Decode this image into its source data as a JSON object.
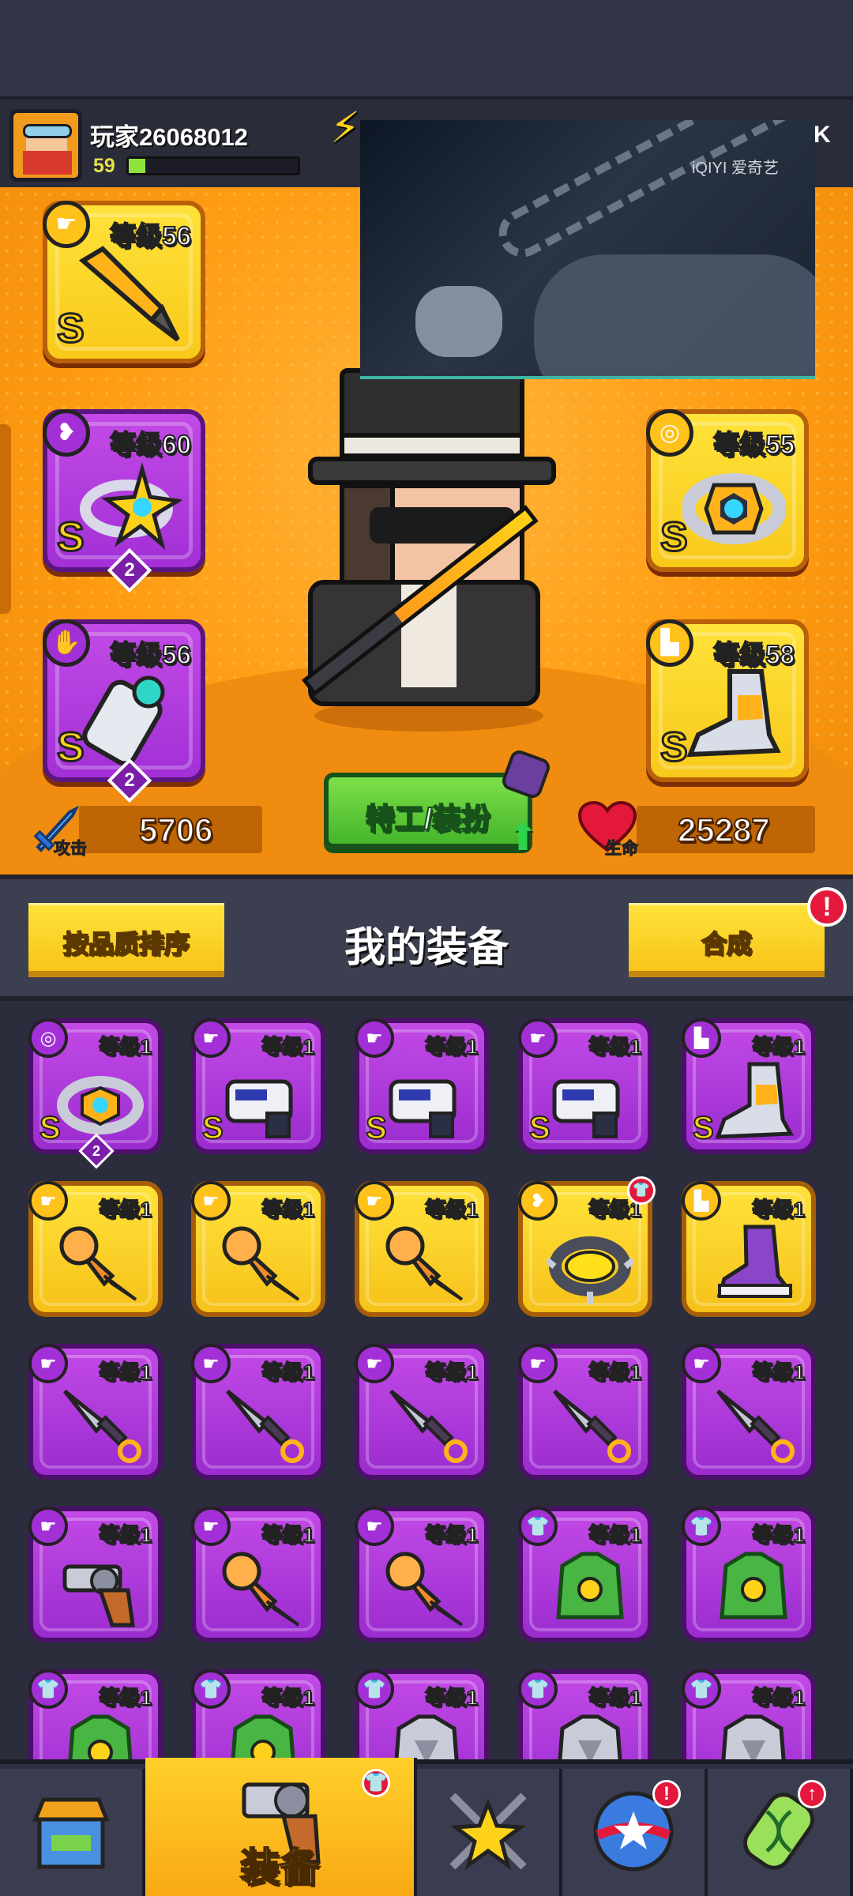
{
  "player": {
    "name": "玩家26068012",
    "level": "59",
    "xp_fraction": 0.1
  },
  "hud": {
    "k_label": "K"
  },
  "video": {
    "watermark": "iQIYI 爱奇艺"
  },
  "equipped": [
    {
      "level": "等级56",
      "grade": "S",
      "slot_icon": "pistol-icon",
      "item": "flame-sword",
      "rarity": "gold"
    },
    {
      "level": "等级60",
      "grade": "S",
      "slot_icon": "necklace-icon",
      "item": "star-ring",
      "rarity": "purple",
      "stars": "2"
    },
    {
      "level": "等级56",
      "grade": "S",
      "slot_icon": "glove-icon",
      "item": "gauntlet",
      "rarity": "purple",
      "stars": "2"
    },
    {
      "level": "等级55",
      "grade": "S",
      "slot_icon": "belt-icon",
      "item": "gem-belt",
      "rarity": "gold"
    },
    {
      "level": "等级58",
      "grade": "S",
      "slot_icon": "boot-icon",
      "item": "mech-boots",
      "rarity": "gold"
    }
  ],
  "stats": {
    "attack_label": "攻击",
    "attack": "5706",
    "hp_label": "生命",
    "hp": "25287"
  },
  "buttons": {
    "special": "特工/装扮",
    "sort": "按品质排序",
    "merge": "合成",
    "merge_alert": "!"
  },
  "panel_title": "我的装备",
  "inventory": [
    {
      "level": "等级1",
      "grade": "S",
      "rarity": "purple",
      "icon": "belt-icon",
      "item": "gem-belt",
      "stars": "2"
    },
    {
      "level": "等级1",
      "grade": "S",
      "rarity": "purple",
      "icon": "pistol-icon",
      "item": "blaster"
    },
    {
      "level": "等级1",
      "grade": "S",
      "rarity": "purple",
      "icon": "pistol-icon",
      "item": "blaster"
    },
    {
      "level": "等级1",
      "grade": "S",
      "rarity": "purple",
      "icon": "pistol-icon",
      "item": "blaster"
    },
    {
      "level": "等级1",
      "grade": "S",
      "rarity": "purple",
      "icon": "boot-icon",
      "item": "mech-boots"
    },
    {
      "level": "等级1",
      "rarity": "gold",
      "icon": "pistol-icon",
      "item": "drill"
    },
    {
      "level": "等级1",
      "rarity": "gold",
      "icon": "pistol-icon",
      "item": "drill"
    },
    {
      "level": "等级1",
      "rarity": "gold",
      "icon": "pistol-icon",
      "item": "drill"
    },
    {
      "level": "等级1",
      "rarity": "gold",
      "icon": "necklace-icon",
      "item": "spiked-collar",
      "alert": true
    },
    {
      "level": "等级1",
      "rarity": "gold",
      "icon": "boot-icon",
      "item": "sneaker"
    },
    {
      "level": "等级1",
      "rarity": "purple",
      "icon": "pistol-icon",
      "item": "kunai"
    },
    {
      "level": "等级1",
      "rarity": "purple",
      "icon": "pistol-icon",
      "item": "kunai"
    },
    {
      "level": "等级1",
      "rarity": "purple",
      "icon": "pistol-icon",
      "item": "kunai"
    },
    {
      "level": "等级1",
      "rarity": "purple",
      "icon": "pistol-icon",
      "item": "kunai"
    },
    {
      "level": "等级1",
      "rarity": "purple",
      "icon": "pistol-icon",
      "item": "kunai"
    },
    {
      "level": "等级1",
      "rarity": "purple",
      "icon": "pistol-icon",
      "item": "revolver"
    },
    {
      "level": "等级1",
      "rarity": "purple",
      "icon": "pistol-icon",
      "item": "drill"
    },
    {
      "level": "等级1",
      "rarity": "purple",
      "icon": "pistol-icon",
      "item": "drill"
    },
    {
      "level": "等级1",
      "rarity": "purple",
      "icon": "shirt-icon",
      "item": "leaf-armor"
    },
    {
      "level": "等级1",
      "rarity": "purple",
      "icon": "shirt-icon",
      "item": "leaf-armor"
    },
    {
      "level": "等级1",
      "rarity": "purple",
      "icon": "shirt-icon",
      "item": "leaf-armor"
    },
    {
      "level": "等级1",
      "rarity": "purple",
      "icon": "shirt-icon",
      "item": "leaf-armor"
    },
    {
      "level": "等级1",
      "rarity": "purple",
      "icon": "shirt-icon",
      "item": "steel-armor"
    },
    {
      "level": "等级1",
      "rarity": "purple",
      "icon": "shirt-icon",
      "item": "steel-armor"
    },
    {
      "level": "等级1",
      "rarity": "purple",
      "icon": "shirt-icon",
      "item": "steel-armor"
    }
  ],
  "nav": [
    {
      "id": "shop",
      "icon": "shop-icon",
      "label": ""
    },
    {
      "id": "equipment",
      "icon": "revolver-icon",
      "label": "装备",
      "active": true,
      "alert": true
    },
    {
      "id": "battle",
      "icon": "crossed-swords-star-icon",
      "label": ""
    },
    {
      "id": "gacha",
      "icon": "star-ball-icon",
      "label": "",
      "alert": true,
      "alert_text": "!"
    },
    {
      "id": "lab",
      "icon": "dna-capsule-icon",
      "label": "",
      "alert": true,
      "alert_text": "↑"
    }
  ],
  "colors": {
    "stage": "#ff9c12",
    "gold": "#ffd21a",
    "purple": "#a230d6",
    "green": "#45b52a",
    "alert": "#e3183b"
  }
}
